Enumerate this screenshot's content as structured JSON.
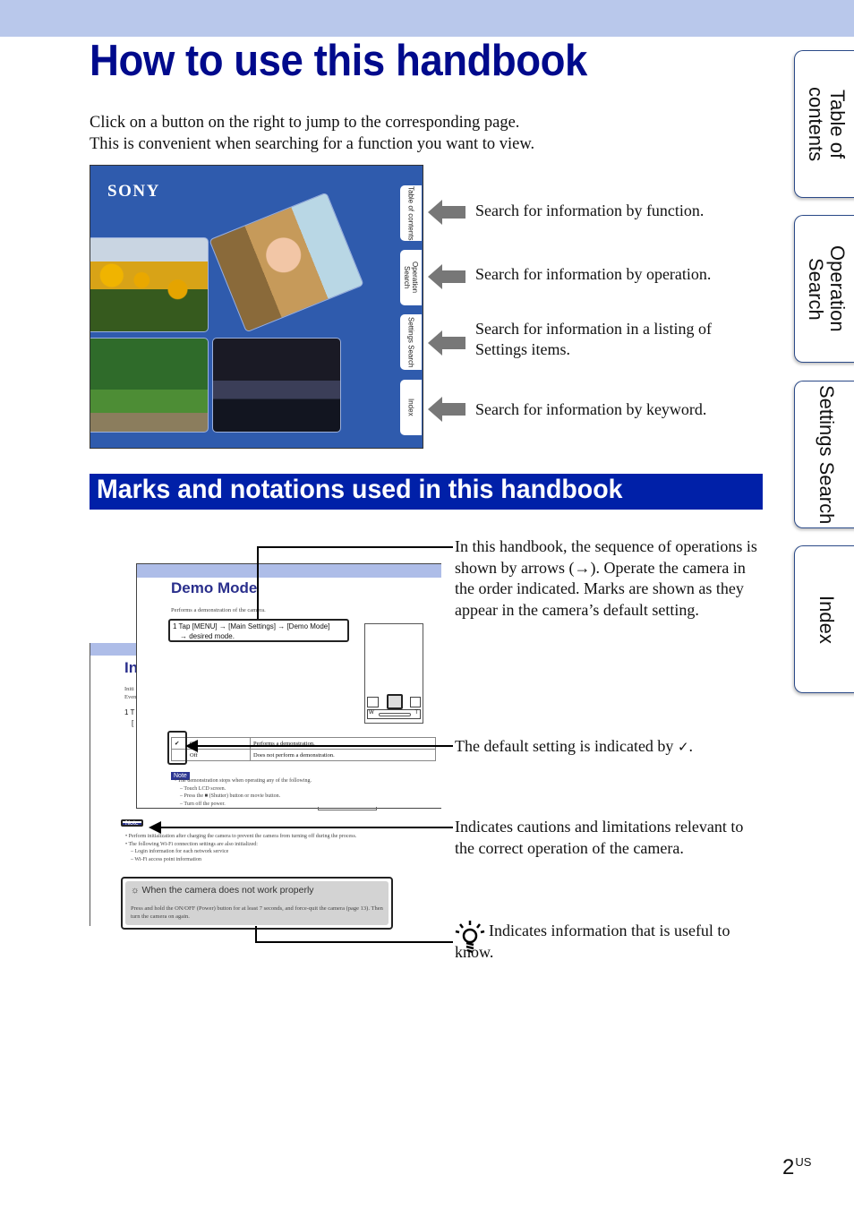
{
  "header": {
    "title": "How to use this handbook"
  },
  "intro": [
    "Click on a button on the right to jump to the corresponding page.",
    "This is convenient when searching for a function you want to view."
  ],
  "cover": {
    "brand": "SONY",
    "tabs": [
      "Table of contents",
      "Operation Search",
      "Settings Search",
      "Index"
    ]
  },
  "cover_descriptions": [
    "Search for information by function.",
    "Search for information by operation.",
    "Search for information in a listing of Settings items.",
    "Search for information by keyword."
  ],
  "section": {
    "title": "Marks and notations used in this handbook"
  },
  "sample": {
    "back_title": "In",
    "back_text_1": "Initi",
    "back_text_2": "Even",
    "back_step": "1 T",
    "back_step2": "[",
    "demo_title": "Demo Mode",
    "demo_desc": "Performs a demonstration of the camera.",
    "step_line1": "1  Tap [MENU] → [Main Settings] → [Demo Mode]",
    "step_line2": "→ desired mode.",
    "phone_buttons": [
      "W",
      "T"
    ],
    "settings": [
      {
        "option": "On",
        "description": "Performs a demonstration.",
        "default": true
      },
      {
        "option": "Off",
        "description": "Does not perform a demonstration.",
        "default": false
      }
    ],
    "note_label": "Note",
    "note_items": [
      "•  The demonstration stops when operating any of the following.",
      "–  Touch LCD screen.",
      "–  Press the ■ (Shutter) button or movie button.",
      "–  Turn off the power."
    ],
    "note2_label": "Note",
    "note2_items": [
      "•  Perform initialization after charging the camera to prevent the camera from turning off during the process.",
      "•  The following Wi-Fi connection settings are also initialized:",
      "–  Login information for each network service",
      "–  Wi-Fi access point information"
    ],
    "hint_title": "When the camera does not work properly",
    "hint_text": "Press and hold the ON/OFF (Power) button for at least 7 seconds, and force-quit the camera (page 13). Then turn the camera on again."
  },
  "annotations": {
    "arrows": "In this handbook, the sequence of operations is shown by arrows (→). Operate the camera in the order indicated. Marks are shown as they appear in the camera’s default setting.",
    "default": "The default setting is indicated by",
    "default_end": ".",
    "note": "Indicates cautions and limitations relevant to the correct operation of the camera.",
    "hint": "Indicates information that is useful to know."
  },
  "side_tabs": [
    "Table of contents",
    "Operation Search",
    "Settings Search",
    "Index"
  ],
  "page": {
    "number": "2",
    "suffix": "US"
  }
}
